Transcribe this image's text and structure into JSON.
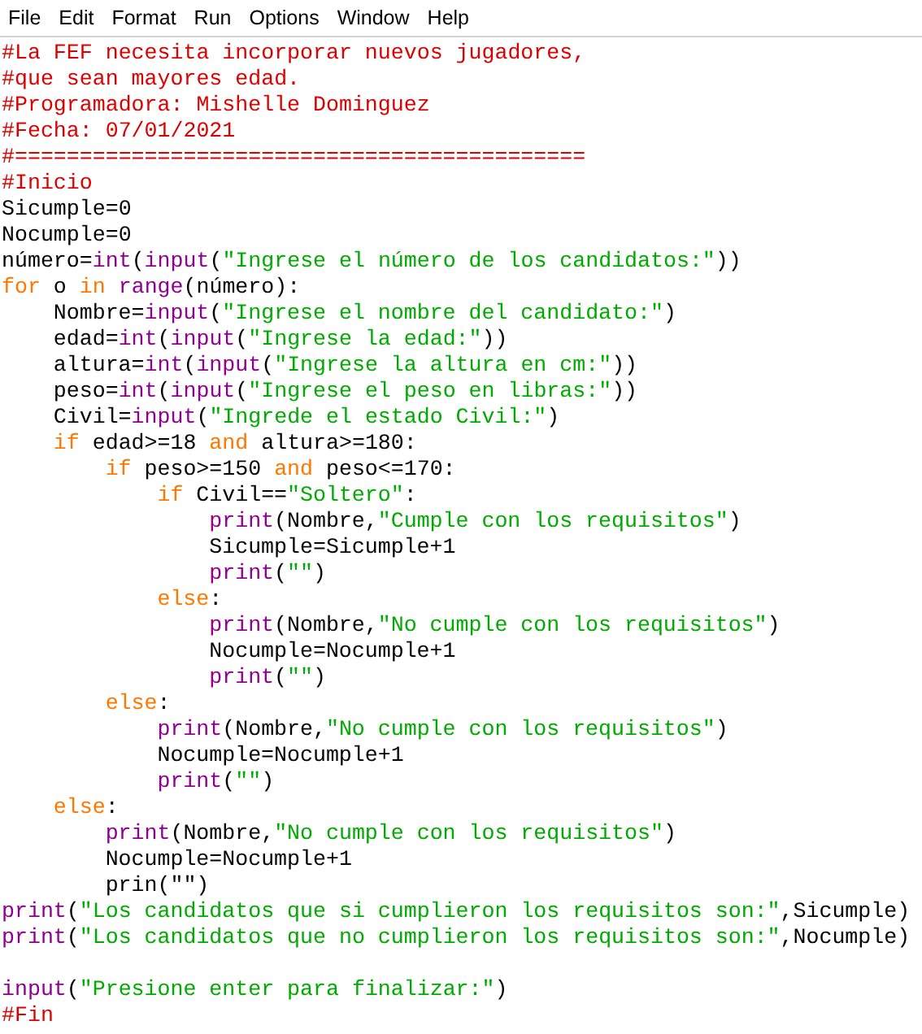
{
  "menu_bar": [
    "File",
    "Edit",
    "Format",
    "Run",
    "Options",
    "Window",
    "Help"
  ],
  "editor": {
    "lines": [
      {
        "kind": "code",
        "tokens": [
          {
            "kind": "comment",
            "text": "#La FEF necesita incorporar nuevos jugadores,"
          }
        ]
      },
      {
        "kind": "code",
        "tokens": [
          {
            "kind": "comment",
            "text": "#que sean mayores edad."
          }
        ]
      },
      {
        "kind": "code",
        "tokens": [
          {
            "kind": "comment",
            "text": "#Programadora: Mishelle Dominguez"
          }
        ]
      },
      {
        "kind": "code",
        "tokens": [
          {
            "kind": "comment",
            "text": "#Fecha: 07/01/2021"
          }
        ]
      },
      {
        "kind": "code",
        "tokens": [
          {
            "kind": "comment",
            "text": "#============================================"
          }
        ]
      },
      {
        "kind": "code",
        "tokens": [
          {
            "kind": "comment",
            "text": "#Inicio"
          }
        ]
      },
      {
        "kind": "code",
        "tokens": [
          {
            "kind": "plain",
            "text": "Sicumple=0"
          }
        ]
      },
      {
        "kind": "code",
        "tokens": [
          {
            "kind": "plain",
            "text": "Nocumple=0"
          }
        ]
      },
      {
        "kind": "code",
        "tokens": [
          {
            "kind": "plain",
            "text": "número="
          },
          {
            "kind": "builtin",
            "text": "int"
          },
          {
            "kind": "plain",
            "text": "("
          },
          {
            "kind": "builtin",
            "text": "input"
          },
          {
            "kind": "plain",
            "text": "("
          },
          {
            "kind": "string",
            "text": "\"Ingrese el número de los candidatos:\""
          },
          {
            "kind": "plain",
            "text": "))"
          }
        ]
      },
      {
        "kind": "code",
        "tokens": [
          {
            "kind": "keyword",
            "text": "for"
          },
          {
            "kind": "plain",
            "text": " o "
          },
          {
            "kind": "keyword",
            "text": "in"
          },
          {
            "kind": "builtin",
            "text": " range"
          },
          {
            "kind": "plain",
            "text": "(número):"
          }
        ],
        "children": [
          {
            "kind": "code",
            "tokens": [
              {
                "kind": "plain",
                "text": "Nombre="
              },
              {
                "kind": "builtin",
                "text": "input"
              },
              {
                "kind": "plain",
                "text": "("
              },
              {
                "kind": "string",
                "text": "\"Ingrese el nombre del candidato:\""
              },
              {
                "kind": "plain",
                "text": ")"
              }
            ]
          },
          {
            "kind": "code",
            "tokens": [
              {
                "kind": "plain",
                "text": "edad="
              },
              {
                "kind": "builtin",
                "text": "int"
              },
              {
                "kind": "plain",
                "text": "("
              },
              {
                "kind": "builtin",
                "text": "input"
              },
              {
                "kind": "plain",
                "text": "("
              },
              {
                "kind": "string",
                "text": "\"Ingrese la edad:\""
              },
              {
                "kind": "plain",
                "text": "))"
              }
            ]
          },
          {
            "kind": "code",
            "tokens": [
              {
                "kind": "plain",
                "text": "altura="
              },
              {
                "kind": "builtin",
                "text": "int"
              },
              {
                "kind": "plain",
                "text": "("
              },
              {
                "kind": "builtin",
                "text": "input"
              },
              {
                "kind": "plain",
                "text": "("
              },
              {
                "kind": "string",
                "text": "\"Ingrese la altura en cm:\""
              },
              {
                "kind": "plain",
                "text": "))"
              }
            ]
          },
          {
            "kind": "code",
            "tokens": [
              {
                "kind": "plain",
                "text": "peso="
              },
              {
                "kind": "builtin",
                "text": "int"
              },
              {
                "kind": "plain",
                "text": "("
              },
              {
                "kind": "builtin",
                "text": "input"
              },
              {
                "kind": "plain",
                "text": "("
              },
              {
                "kind": "string",
                "text": "\"Ingrese el peso en libras:\""
              },
              {
                "kind": "plain",
                "text": "))"
              }
            ]
          },
          {
            "kind": "code",
            "tokens": [
              {
                "kind": "plain",
                "text": "Civil="
              },
              {
                "kind": "builtin",
                "text": "input"
              },
              {
                "kind": "plain",
                "text": "("
              },
              {
                "kind": "string",
                "text": "\"Ingrede el estado Civil:\""
              },
              {
                "kind": "plain",
                "text": ")"
              }
            ]
          },
          {
            "kind": "code",
            "tokens": [
              {
                "kind": "keyword",
                "text": "if"
              },
              {
                "kind": "plain",
                "text": " edad>=18 "
              },
              {
                "kind": "keyword",
                "text": "and"
              },
              {
                "kind": "plain",
                "text": " altura>=180:"
              }
            ],
            "children": [
              {
                "kind": "code",
                "tokens": [
                  {
                    "kind": "keyword",
                    "text": "if"
                  },
                  {
                    "kind": "plain",
                    "text": " peso>=150 "
                  },
                  {
                    "kind": "keyword",
                    "text": "and"
                  },
                  {
                    "kind": "plain",
                    "text": " peso<=170:"
                  }
                ],
                "children": [
                  {
                    "kind": "code",
                    "tokens": [
                      {
                        "kind": "keyword",
                        "text": "if"
                      },
                      {
                        "kind": "plain",
                        "text": " Civil=="
                      },
                      {
                        "kind": "string",
                        "text": "\"Soltero\""
                      },
                      {
                        "kind": "plain",
                        "text": ":"
                      }
                    ],
                    "children": [
                      {
                        "kind": "code",
                        "tokens": [
                          {
                            "kind": "builtin",
                            "text": "print"
                          },
                          {
                            "kind": "plain",
                            "text": "(Nombre,"
                          },
                          {
                            "kind": "string",
                            "text": "\"Cumple con los requisitos\""
                          },
                          {
                            "kind": "plain",
                            "text": ")"
                          }
                        ]
                      },
                      {
                        "kind": "code",
                        "tokens": [
                          {
                            "kind": "plain",
                            "text": "Sicumple=Sicumple+1"
                          }
                        ]
                      },
                      {
                        "kind": "code",
                        "tokens": [
                          {
                            "kind": "builtin",
                            "text": "print"
                          },
                          {
                            "kind": "plain",
                            "text": "("
                          },
                          {
                            "kind": "string",
                            "text": "\"\""
                          },
                          {
                            "kind": "plain",
                            "text": ")"
                          }
                        ]
                      }
                    ]
                  },
                  {
                    "kind": "code",
                    "tokens": [
                      {
                        "kind": "keyword",
                        "text": "else"
                      },
                      {
                        "kind": "plain",
                        "text": ":"
                      }
                    ],
                    "children": [
                      {
                        "kind": "code",
                        "tokens": [
                          {
                            "kind": "builtin",
                            "text": "print"
                          },
                          {
                            "kind": "plain",
                            "text": "(Nombre,"
                          },
                          {
                            "kind": "string",
                            "text": "\"No cumple con los requisitos\""
                          },
                          {
                            "kind": "plain",
                            "text": ")"
                          }
                        ]
                      },
                      {
                        "kind": "code",
                        "tokens": [
                          {
                            "kind": "plain",
                            "text": "Nocumple=Nocumple+1"
                          }
                        ]
                      },
                      {
                        "kind": "code",
                        "tokens": [
                          {
                            "kind": "builtin",
                            "text": "print"
                          },
                          {
                            "kind": "plain",
                            "text": "("
                          },
                          {
                            "kind": "string",
                            "text": "\"\""
                          },
                          {
                            "kind": "plain",
                            "text": ")"
                          }
                        ]
                      }
                    ]
                  }
                ]
              },
              {
                "kind": "code",
                "tokens": [
                  {
                    "kind": "keyword",
                    "text": "else"
                  },
                  {
                    "kind": "plain",
                    "text": ":"
                  }
                ],
                "children": [
                  {
                    "kind": "code",
                    "tokens": [
                      {
                        "kind": "builtin",
                        "text": "print"
                      },
                      {
                        "kind": "plain",
                        "text": "(Nombre,"
                      },
                      {
                        "kind": "string",
                        "text": "\"No cumple con los requisitos\""
                      },
                      {
                        "kind": "plain",
                        "text": ")"
                      }
                    ]
                  },
                  {
                    "kind": "code",
                    "tokens": [
                      {
                        "kind": "plain",
                        "text": "Nocumple=Nocumple+1"
                      }
                    ]
                  },
                  {
                    "kind": "code",
                    "tokens": [
                      {
                        "kind": "builtin",
                        "text": "print"
                      },
                      {
                        "kind": "plain",
                        "text": "("
                      },
                      {
                        "kind": "string",
                        "text": "\"\""
                      },
                      {
                        "kind": "plain",
                        "text": ")"
                      }
                    ]
                  }
                ]
              }
            ]
          },
          {
            "kind": "code",
            "tokens": [
              {
                "kind": "keyword",
                "text": "else"
              },
              {
                "kind": "plain",
                "text": ":"
              }
            ],
            "children": [
              {
                "kind": "code",
                "tokens": [
                  {
                    "kind": "builtin",
                    "text": "print"
                  },
                  {
                    "kind": "plain",
                    "text": "(Nombre,"
                  },
                  {
                    "kind": "string",
                    "text": "\"No cumple con los requisitos\""
                  },
                  {
                    "kind": "plain",
                    "text": ")"
                  }
                ]
              },
              {
                "kind": "code",
                "tokens": [
                  {
                    "kind": "plain",
                    "text": "Nocumple=Nocumple+1"
                  }
                ]
              },
              {
                "kind": "code",
                "tokens": [
                  {
                    "kind": "plain",
                    "text": "prin(\"\")"
                  }
                ]
              }
            ]
          }
        ]
      },
      {
        "kind": "code",
        "tokens": [
          {
            "kind": "builtin",
            "text": "print"
          },
          {
            "kind": "plain",
            "text": "("
          },
          {
            "kind": "string",
            "text": "\"Los candidatos que si cumplieron los requisitos son:\""
          },
          {
            "kind": "plain",
            "text": ",Sicumple)"
          }
        ]
      },
      {
        "kind": "code",
        "tokens": [
          {
            "kind": "builtin",
            "text": "print"
          },
          {
            "kind": "plain",
            "text": "("
          },
          {
            "kind": "string",
            "text": "\"Los candidatos que no cumplieron los requisitos son:\""
          },
          {
            "kind": "plain",
            "text": ",Nocumple)"
          }
        ]
      },
      {
        "kind": "blank"
      },
      {
        "kind": "code",
        "tokens": [
          {
            "kind": "builtin",
            "text": "input"
          },
          {
            "kind": "plain",
            "text": "("
          },
          {
            "kind": "string",
            "text": "\"Presione enter para finalizar:\""
          },
          {
            "kind": "plain",
            "text": ")"
          }
        ]
      },
      {
        "kind": "code",
        "tokens": [
          {
            "kind": "comment",
            "text": "#Fin"
          }
        ]
      }
    ]
  }
}
